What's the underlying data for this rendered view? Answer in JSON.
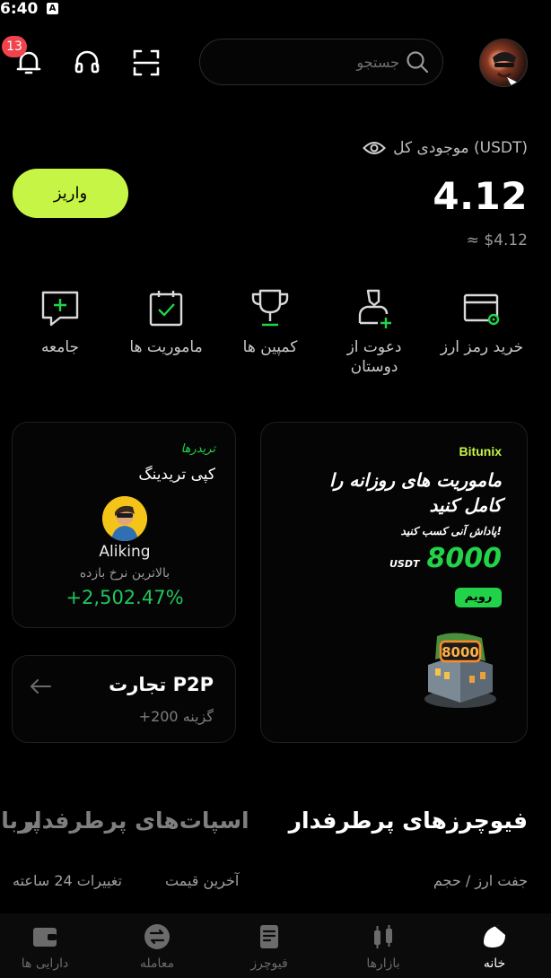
{
  "status_bar": {
    "time": "6:40",
    "indicator": "A"
  },
  "top_bar": {
    "notifications_count": "13",
    "search_placeholder": "جستجو",
    "icons": [
      "bell-icon",
      "headset-icon",
      "scan-icon",
      "search-icon",
      "avatar"
    ]
  },
  "balance": {
    "label": "موجودی کل (USDT)",
    "value": "4.12",
    "usd_equivalent": "≈ $4.12",
    "deposit_label": "واریز"
  },
  "quick_actions": [
    {
      "label": "خرید رمز ارز",
      "icon": "card-icon"
    },
    {
      "label": "دعوت از دوستان",
      "icon": "add-user-icon"
    },
    {
      "label": "کمپین ها",
      "icon": "trophy-icon"
    },
    {
      "label": "ماموریت ها",
      "icon": "task-icon"
    },
    {
      "label": "جامعه",
      "icon": "chat-icon"
    }
  ],
  "promo_card": {
    "brand": "Bitunix",
    "title": "ماموریت های روزانه را کامل کنید",
    "subtitle": "پاداش آنی کسب کنید!",
    "amount": "8000",
    "unit": "USDT",
    "tag": "رویم"
  },
  "copy_trading_card": {
    "tag": "تریدرها",
    "title": "کپی تریدینگ",
    "trader_name": "Aliking",
    "metric_label": "بالاترین نرخ بازده",
    "roi": "+2,502.47%"
  },
  "p2p_card": {
    "title": "تجارت P2P",
    "subtitle": "+200 گزینه"
  },
  "market_tabs": [
    {
      "label": "فیوچرزهای پرطرفدار",
      "active": true
    },
    {
      "label": "اسپات‌های پرطرفدار",
      "active": false
    },
    {
      "label": "پربا",
      "active": false
    }
  ],
  "market_columns": {
    "pair_volume": "جفت ارز / حجم",
    "last_price": "آخرین قیمت",
    "change_24h": "تغییرات 24 ساعته"
  },
  "bottom_nav": [
    {
      "label": "خانه",
      "icon": "home-icon",
      "active": true
    },
    {
      "label": "بازارها",
      "icon": "markets-icon",
      "active": false
    },
    {
      "label": "فیوچرز",
      "icon": "futures-icon",
      "active": false
    },
    {
      "label": "معامله",
      "icon": "trade-icon",
      "active": false
    },
    {
      "label": "دارایی ها",
      "icon": "wallet-icon",
      "active": false
    }
  ],
  "colors": {
    "accent": "#c7f546",
    "positive": "#22c55e",
    "badge": "#f0434b",
    "background": "#000000"
  }
}
